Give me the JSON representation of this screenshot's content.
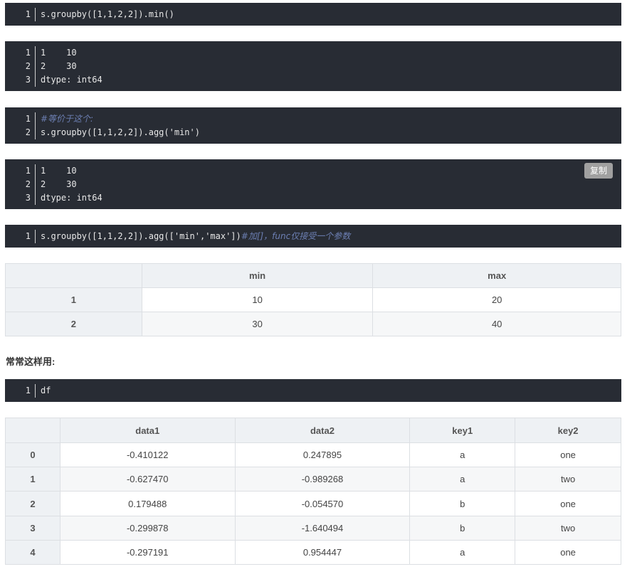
{
  "blocks": {
    "code1": {
      "lines": [
        {
          "n": "1",
          "text": "s.groupby([1,1,2,2]).min()"
        }
      ]
    },
    "out1": {
      "lines": [
        {
          "n": "1",
          "text": "1    10"
        },
        {
          "n": "2",
          "text": "2    30"
        },
        {
          "n": "3",
          "text": "dtype: int64"
        }
      ]
    },
    "code2": {
      "lines": [
        {
          "n": "1",
          "text": "#等价于这个:"
        },
        {
          "n": "2",
          "text": "s.groupby([1,1,2,2]).agg('min')"
        }
      ]
    },
    "out2": {
      "lines": [
        {
          "n": "1",
          "text": "1    10"
        },
        {
          "n": "2",
          "text": "2    30"
        },
        {
          "n": "3",
          "text": "dtype: int64"
        }
      ],
      "copy_label": "复制"
    },
    "code3": {
      "lines": [
        {
          "n": "1",
          "text": "s.groupby([1,1,2,2]).agg(['min','max'])",
          "comment": "#加[]，func仅接受一个参数"
        }
      ]
    },
    "code4": {
      "lines": [
        {
          "n": "1",
          "text": "df"
        }
      ]
    }
  },
  "table1": {
    "headers": [
      "",
      "min",
      "max"
    ],
    "rows": [
      [
        "1",
        "10",
        "20"
      ],
      [
        "2",
        "30",
        "40"
      ]
    ]
  },
  "note": "常常这样用:",
  "table2": {
    "headers": [
      "",
      "data1",
      "data2",
      "key1",
      "key2"
    ],
    "rows": [
      [
        "0",
        "-0.410122",
        "0.247895",
        "a",
        "one"
      ],
      [
        "1",
        "-0.627470",
        "-0.989268",
        "a",
        "two"
      ],
      [
        "2",
        "0.179488",
        "-0.054570",
        "b",
        "one"
      ],
      [
        "3",
        "-0.299878",
        "-1.640494",
        "b",
        "two"
      ],
      [
        "4",
        "-0.297191",
        "0.954447",
        "a",
        "one"
      ]
    ]
  }
}
